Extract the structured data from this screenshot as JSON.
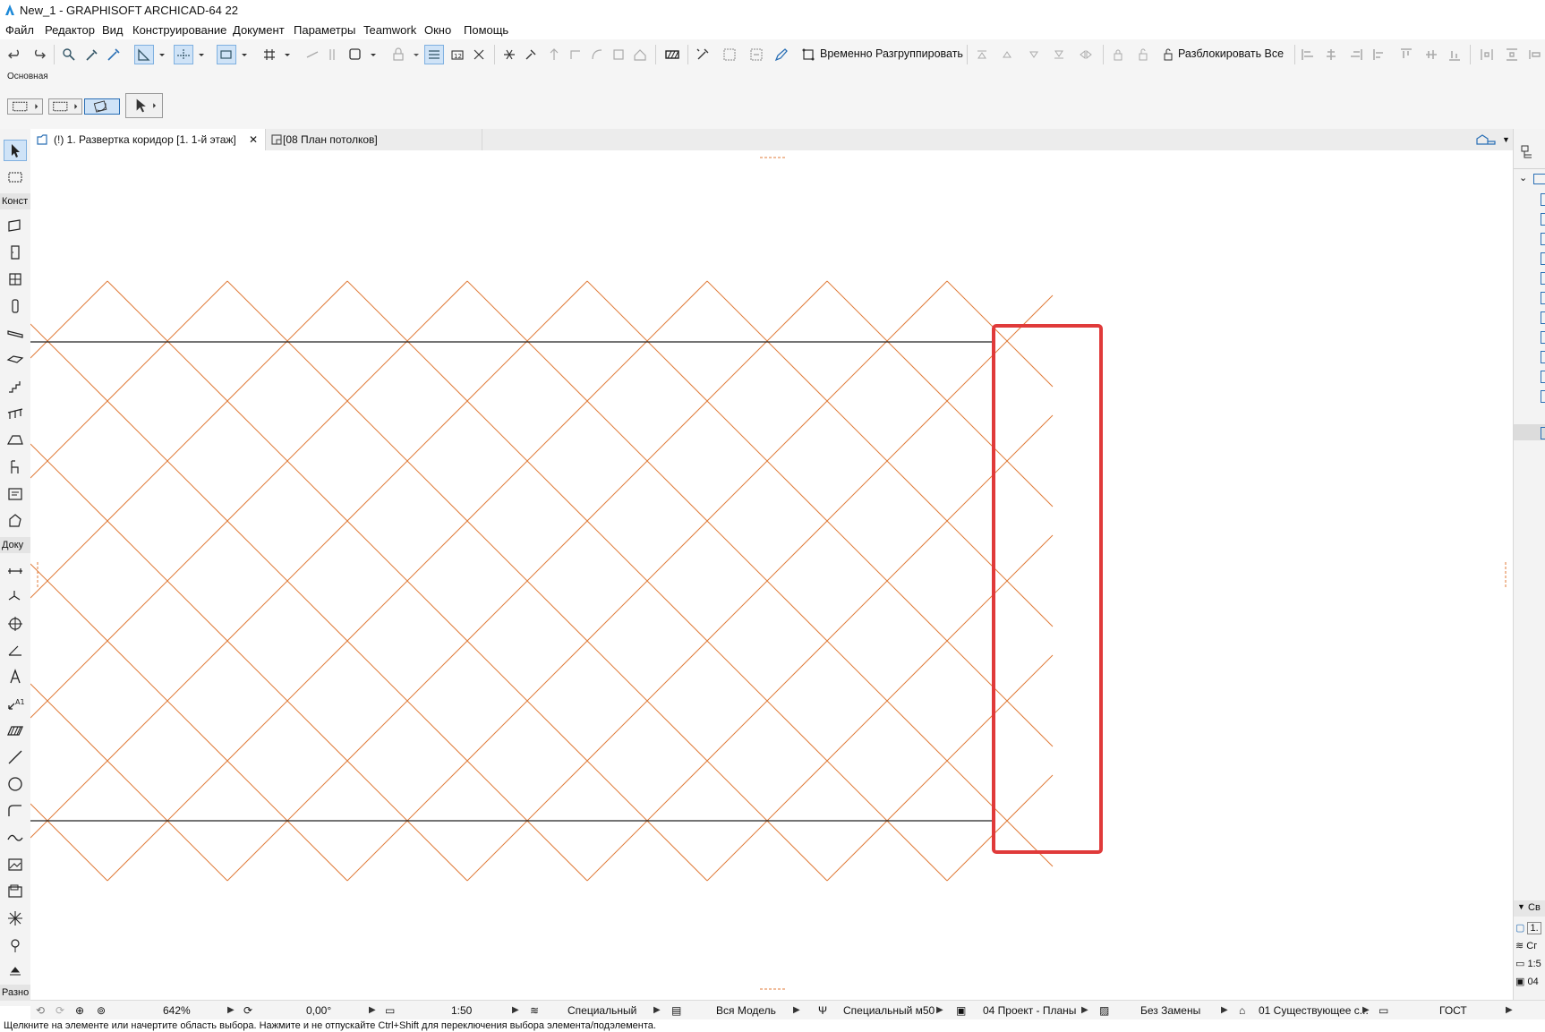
{
  "window": {
    "title": "New_1 - GRAPHISOFT ARCHICAD-64 22"
  },
  "menu": [
    "Файл",
    "Редактор",
    "Вид",
    "Конструирование",
    "Документ",
    "Параметры",
    "Teamwork",
    "Окно",
    "Помощь"
  ],
  "toolbar": {
    "ungroup_label": "Временно Разгруппировать",
    "unlock_label": "Разблокировать Все"
  },
  "infobox": {
    "label": "Основная"
  },
  "left_toolbox": {
    "section_construct": "Конст",
    "section_document": "Доку",
    "section_misc": "Разно"
  },
  "tabs": [
    {
      "label": "(!) 1. Развертка коридор [1. 1-й этаж]",
      "active": true
    },
    {
      "label": "[08 План потолков]",
      "active": false
    }
  ],
  "drawing": {
    "pattern_color": "#e07b39",
    "boundary_color": "#222222",
    "highlight_color": "#e03a3a"
  },
  "statusbar": {
    "zoom": "642%",
    "angle": "0,00°",
    "scale": "1:50",
    "layer_combo": "Специальный",
    "model_view": "Вся Модель",
    "pen_set": "Специальный м50",
    "view_set": "04 Проект - Планы",
    "override": "Без Замены",
    "renovation": "01 Существующее с...",
    "dimension": "ГОСТ"
  },
  "right_panel": {
    "properties_label": "Св",
    "items": [
      "1.",
      "Сг",
      "1:5",
      "04"
    ]
  },
  "hint": "Щелкните на элементе или начертите область выбора. Нажмите и не отпускайте Ctrl+Shift для переключения выбора элемента/подэлемента."
}
